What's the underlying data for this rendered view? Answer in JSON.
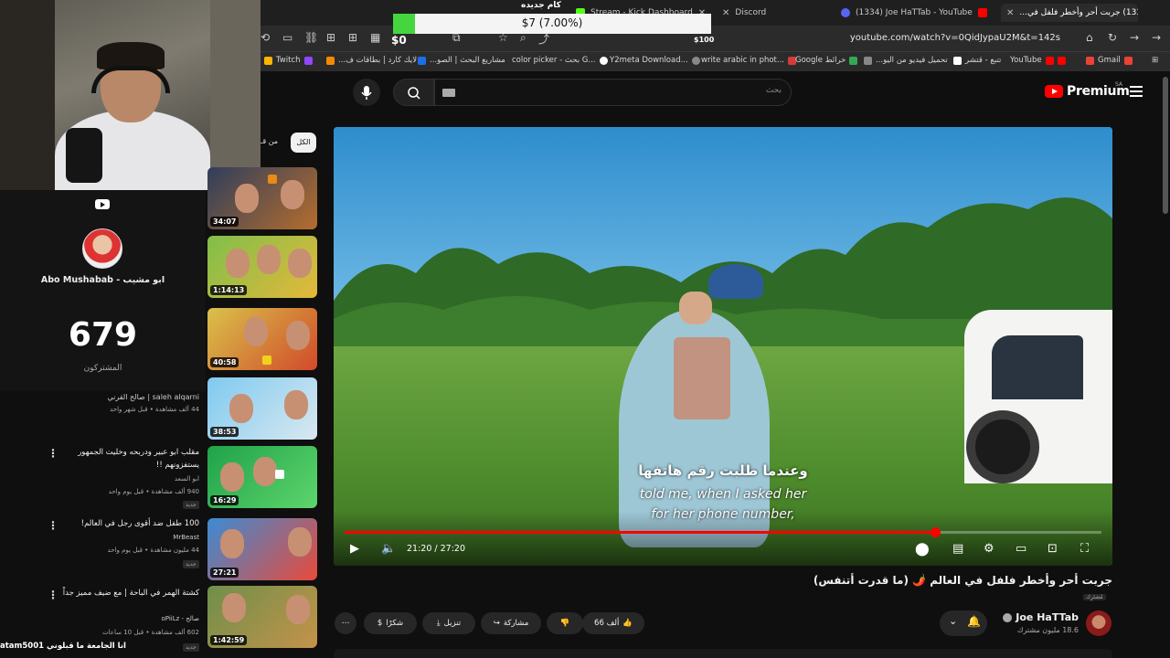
{
  "tabs": [
    {
      "label": "Stream - Kick Dashboard",
      "active": false
    },
    {
      "label": "Discord",
      "active": false
    },
    {
      "label": "(1334) Joe HaTTab - YouTube",
      "active": false
    },
    {
      "label": "(1333) جربت أحر وأخطر فلفل في...",
      "active": true
    }
  ],
  "url": "youtube.com/watch?v=0QidJypaU2M&t=142s",
  "bookmarks": [
    "Twitch",
    "لايك كارد | بطاقات ف...",
    "مشاريع البحث | الصو...",
    "color picker - بحث G...",
    "Y2meta Download...",
    "write arabic in phot...",
    "Google خرائط",
    "تحميل فيديو من اليو...",
    "تتبع - قتشر",
    "YouTube",
    "Gmail"
  ],
  "goal": {
    "title": "كام جديده",
    "text": "$7 (7.00%)",
    "percent": 7.0,
    "min": "$0",
    "max": "$100",
    "color": "#45d63f"
  },
  "channel_card": {
    "name": "Abo Mushabab - ابو مشيب",
    "subscribers": "679",
    "subscribers_label": "المشتركون"
  },
  "chips": {
    "all": "الكل",
    "from": "من قـ"
  },
  "recommendations": [
    {
      "duration": "34:07"
    },
    {
      "duration": "1:14:13"
    },
    {
      "duration": "40:58"
    },
    {
      "duration": "38:53",
      "meta_channel": "صالح القرني | saleh alqarni",
      "meta_views": "44 ألف مشاهدة • قبل شهر واحد"
    },
    {
      "duration": "16:29",
      "title": "مقلب ابو عبير ودربحه وخليت الجمهور",
      "title2": "يستفزونهم !!",
      "channel": "ابو السعد",
      "views": "940 ألف مشاهدة • قبل يوم واحد",
      "badge": "جديد"
    },
    {
      "duration": "27:21",
      "title": "100 طفل ضد أقوى رجل في العالم!",
      "channel": "MrBeast",
      "views": "44 مليون مشاهدة • قبل يوم واحد",
      "badge": "جديد"
    },
    {
      "duration": "1:42:59",
      "title": "كشتة الهمر في الباحة | مع ضيف مميز جداً",
      "channel": "oPiiLz - صالح",
      "views": "602 ألف مشاهدة • قبل 10 ساعات",
      "badge": "جديد"
    }
  ],
  "search": {
    "placeholder": "بحث"
  },
  "logo": {
    "text": "Premium",
    "country": "SA"
  },
  "player": {
    "subtitle_ar": "وعندما طلبت رقم هاتفها",
    "subtitle_en_1": "told me, when I asked her",
    "subtitle_en_2": "for her phone number,",
    "time": "21:20 / 27:20",
    "progress": 0.7805,
    "progress_color": "#ff0000"
  },
  "video": {
    "title": "جربت أحر وأخطر فلفل في العالم 🌶️ (ما قدرت أتنفس)",
    "tag": "مُشتَرِك",
    "owner": "Joe HaTTab",
    "owner_subs": "18.6 مليون مشترك",
    "likes": "66 ألف",
    "share": "مشاركة",
    "download": "تنزيل",
    "thanks": "شكرًا"
  },
  "chat": {
    "user": "atam5001",
    "message": "انا الجامعة ما قبلوني"
  }
}
